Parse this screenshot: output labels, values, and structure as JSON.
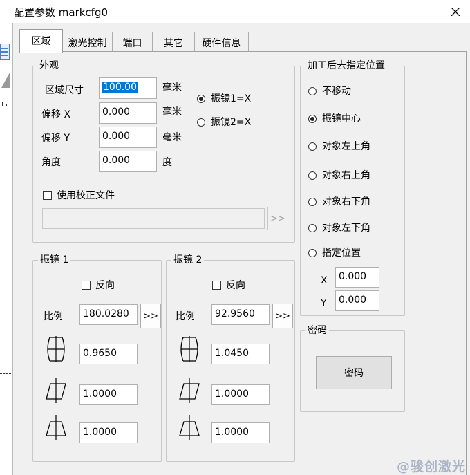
{
  "window": {
    "title": "配置参数 markcfg0"
  },
  "tabs": [
    {
      "label": "区域"
    },
    {
      "label": "激光控制"
    },
    {
      "label": "端口"
    },
    {
      "label": "其它"
    },
    {
      "label": "硬件信息"
    }
  ],
  "appearance": {
    "legend": "外观",
    "area_size": {
      "label": "区域尺寸",
      "value": "100.00",
      "unit": "毫米"
    },
    "offset_x": {
      "label": "偏移 X",
      "value": "0.000",
      "unit": "毫米"
    },
    "offset_y": {
      "label": "偏移 Y",
      "value": "0.000",
      "unit": "毫米"
    },
    "angle": {
      "label": "角度",
      "value": "0.000",
      "unit": "度"
    },
    "galvo_map": [
      {
        "label": "振镜1=X",
        "checked": true
      },
      {
        "label": "振镜2=X",
        "checked": false
      }
    ],
    "use_correction_file": {
      "label": "使用校正文件",
      "checked": false
    },
    "file_path": "",
    "browse_label": ">>"
  },
  "galvo1": {
    "legend": "振镜 1",
    "reverse": {
      "label": "反向",
      "checked": false
    },
    "scale": {
      "label": "比例",
      "value": "180.0280"
    },
    "browse_label": ">>",
    "barrel": "0.9650",
    "trapezoid_left": "1.0000",
    "trapezoid_top": "1.0000"
  },
  "galvo2": {
    "legend": "振镜 2",
    "reverse": {
      "label": "反向",
      "checked": false
    },
    "scale": {
      "label": "比例",
      "value": "92.9560"
    },
    "browse_label": ">>",
    "barrel": "1.0450",
    "trapezoid_left": "1.0000",
    "trapezoid_top": "1.0000"
  },
  "post_process": {
    "legend": "加工后去指定位置",
    "options": [
      {
        "label": "不移动",
        "checked": false
      },
      {
        "label": "振镜中心",
        "checked": true
      },
      {
        "label": "对象左上角",
        "checked": false
      },
      {
        "label": "对象右上角",
        "checked": false
      },
      {
        "label": "对象右下角",
        "checked": false
      },
      {
        "label": "对象左下角",
        "checked": false
      },
      {
        "label": "指定位置",
        "checked": false
      }
    ],
    "x": {
      "label": "X",
      "value": "0.000"
    },
    "y": {
      "label": "Y",
      "value": "0.000"
    }
  },
  "password": {
    "legend": "密码",
    "button_label": "密码"
  },
  "watermark": "@骏创激光"
}
